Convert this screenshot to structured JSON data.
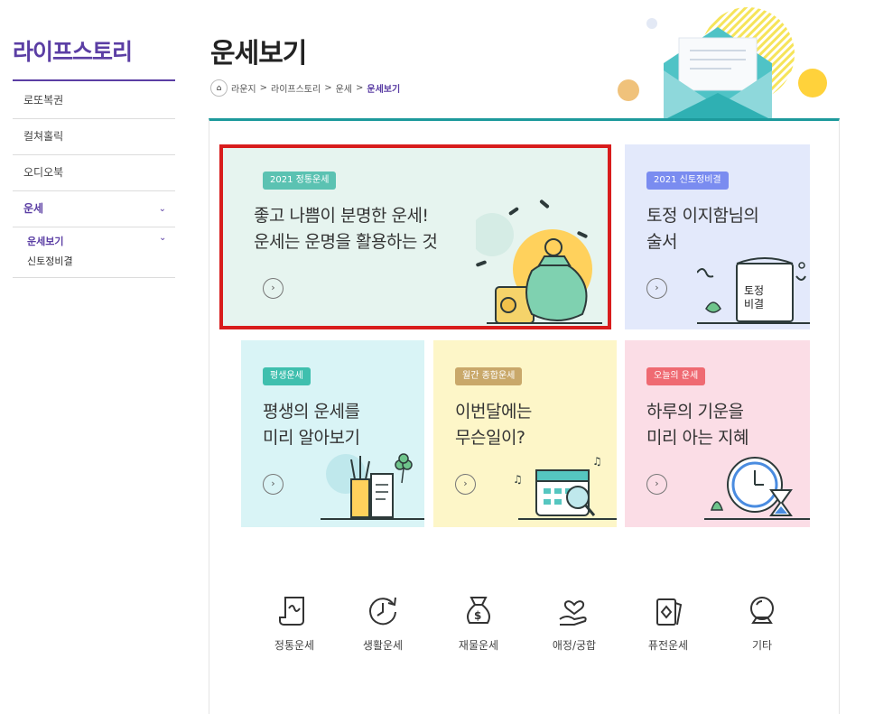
{
  "sidebar": {
    "title": "라이프스토리",
    "items": [
      {
        "label": "로또복권"
      },
      {
        "label": "컬쳐홀릭"
      },
      {
        "label": "오디오북"
      },
      {
        "label": "운세"
      }
    ],
    "submenu": [
      {
        "label": "운세보기"
      },
      {
        "label": "신토정비결"
      }
    ]
  },
  "header": {
    "title": "운세보기",
    "breadcrumb": [
      "라운지",
      ">",
      "라이프스토리",
      ">",
      "운세",
      ">",
      "운세보기"
    ]
  },
  "cards": [
    {
      "badge": "2021 정통운세",
      "line1": "좋고 나쁨이 분명한 운세!",
      "line2": "운세는 운명을 활용하는 것"
    },
    {
      "badge": "2021 신토정비결",
      "line1": "토정 이지함님의",
      "line2": "술서",
      "illus_text1": "토정",
      "illus_text2": "비결"
    },
    {
      "badge": "평생운세",
      "line1": "평생의 운세를",
      "line2": "미리 알아보기"
    },
    {
      "badge": "월간 종합운세",
      "line1": "이번달에는",
      "line2": "무슨일이?"
    },
    {
      "badge": "오늘의 운세",
      "line1": "하루의 기운을",
      "line2": "미리 아는 지혜"
    }
  ],
  "quick_links": [
    {
      "label": "정통운세",
      "icon": "scroll-icon"
    },
    {
      "label": "생활운세",
      "icon": "clock-refresh-icon"
    },
    {
      "label": "재물운세",
      "icon": "money-bag-icon"
    },
    {
      "label": "애정/궁합",
      "icon": "heart-hand-icon"
    },
    {
      "label": "퓨전운세",
      "icon": "card-diamond-icon"
    },
    {
      "label": "기타",
      "icon": "crystal-ball-icon"
    }
  ],
  "colors": {
    "brand": "#5b3ea4",
    "accent": "#1d9a9c",
    "highlight": "#d81c1c"
  }
}
